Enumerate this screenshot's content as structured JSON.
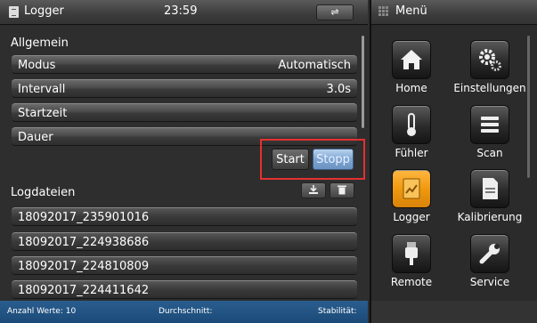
{
  "header": {
    "title": "Logger",
    "time": "23:59",
    "usb_label": "⇌"
  },
  "general": {
    "section_label": "Allgemein",
    "rows": [
      {
        "label": "Modus",
        "value": "Automatisch"
      },
      {
        "label": "Intervall",
        "value": "3.0s"
      },
      {
        "label": "Startzeit",
        "value": ""
      },
      {
        "label": "Dauer",
        "value": ""
      }
    ]
  },
  "controls": {
    "start_label": "Start",
    "stop_label": "Stopp"
  },
  "logfiles": {
    "section_label": "Logdateien",
    "files": [
      "18092017_235901016",
      "18092017_224938686",
      "18092017_224810809",
      "18092017_224411642"
    ]
  },
  "status": {
    "count_label": "Anzahl Werte: 10",
    "average_label": "Durchschnitt:",
    "stability_label": "Stabilität:"
  },
  "menu": {
    "title": "Menü",
    "items": [
      {
        "label": "Home",
        "icon": "home-icon"
      },
      {
        "label": "Einstellungen",
        "icon": "gears-icon"
      },
      {
        "label": "Fühler",
        "icon": "thermometer-icon"
      },
      {
        "label": "Scan",
        "icon": "scan-icon"
      },
      {
        "label": "Logger",
        "icon": "logger-icon",
        "active": true
      },
      {
        "label": "Kalibrierung",
        "icon": "calibration-doc-icon"
      },
      {
        "label": "Remote",
        "icon": "plug-icon"
      },
      {
        "label": "Service",
        "icon": "wrench-icon"
      }
    ]
  },
  "colors": {
    "accent": "#f09a10",
    "status_bar": "#1f4f80",
    "stop_button": "#7fa5d2",
    "highlight": "#e53030"
  }
}
